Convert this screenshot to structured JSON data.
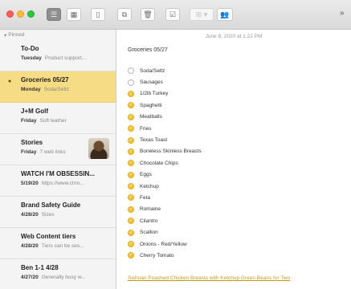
{
  "toolbar": {
    "buttons": [
      {
        "name": "list-view-button",
        "icon": "list-icon",
        "glyph": "☰",
        "state": "active"
      },
      {
        "name": "gallery-view-button",
        "icon": "grid-icon",
        "glyph": "▦",
        "state": "normal"
      },
      {
        "name": "sidebar-toggle-button",
        "icon": "sidebar-icon",
        "glyph": "▯",
        "state": "normal"
      },
      {
        "name": "compose-button",
        "icon": "compose-icon",
        "glyph": "⧉",
        "state": "normal"
      },
      {
        "name": "delete-button",
        "icon": "trash-icon",
        "glyph": "🗑",
        "state": "normal"
      },
      {
        "name": "checklist-button",
        "icon": "checklist-icon",
        "glyph": "☑",
        "state": "normal"
      },
      {
        "name": "format-button",
        "icon": "table-icon",
        "glyph": "⊞ ▾",
        "state": "disabled"
      },
      {
        "name": "share-button",
        "icon": "share-icon",
        "glyph": "👥",
        "state": "normal"
      }
    ],
    "overflow": "»"
  },
  "sidebar": {
    "pinned_label": "Pinned",
    "notes": [
      {
        "title": "To-Do",
        "date": "Tuesday",
        "preview": "Product support...",
        "selected": false,
        "pinned": false,
        "thumbnail": false
      },
      {
        "title": "Groceries 05/27",
        "date": "Monday",
        "preview": "Soda/Seltz",
        "selected": true,
        "pinned": true,
        "thumbnail": false
      },
      {
        "title": "J+M Golf",
        "date": "Friday",
        "preview": "Soft leather",
        "selected": false,
        "pinned": false,
        "thumbnail": false
      },
      {
        "title": "Stories",
        "date": "Friday",
        "preview": "7 web links",
        "selected": false,
        "pinned": false,
        "thumbnail": true
      },
      {
        "title": "WATCH I'M OBSESSIN...",
        "date": "5/19/20",
        "preview": "https://www.chro...",
        "selected": false,
        "pinned": false,
        "thumbnail": false
      },
      {
        "title": "Brand Safety Guide",
        "date": "4/28/20",
        "preview": "Sizes",
        "selected": false,
        "pinned": false,
        "thumbnail": false
      },
      {
        "title": "Web Content tiers",
        "date": "4/28/20",
        "preview": "Tiers can be ses...",
        "selected": false,
        "pinned": false,
        "thumbnail": false
      },
      {
        "title": "Ben 1-1 4/28",
        "date": "4/27/20",
        "preview": "Generally busy w...",
        "selected": false,
        "pinned": false,
        "thumbnail": false
      }
    ]
  },
  "editor": {
    "timestamp": "June 8, 2020 at 1:22 PM",
    "heading": "Groceries 05/27",
    "checklist": [
      {
        "text": "Soda/Seltz",
        "checked": false
      },
      {
        "text": "Sausages",
        "checked": false
      },
      {
        "text": "1/2lb Turkey",
        "checked": true
      },
      {
        "text": "Spaghetti",
        "checked": true
      },
      {
        "text": "Meatballs",
        "checked": true
      },
      {
        "text": "Fries",
        "checked": true
      },
      {
        "text": "Texas Toast",
        "checked": true
      },
      {
        "text": "Boneless Skinless Breasts",
        "checked": true
      },
      {
        "text": "Chocolate Chips",
        "checked": true
      },
      {
        "text": "Eggs",
        "checked": true
      },
      {
        "text": "Ketchup",
        "checked": true
      },
      {
        "text": "Feta",
        "checked": true
      },
      {
        "text": "Romaine",
        "checked": true
      },
      {
        "text": "Cilantro",
        "checked": true
      },
      {
        "text": "Scallion",
        "checked": true
      },
      {
        "text": "Onions - Red/Yellow",
        "checked": true
      },
      {
        "text": "Cherry Tomato",
        "checked": true
      }
    ],
    "link_text": "Sichuan Poached Chicken Breasts with Ketchup Green Beans for Two"
  },
  "colors": {
    "accent": "#f5c12e",
    "selected_note_bg": "#f7dc86",
    "link": "#c79a16"
  }
}
